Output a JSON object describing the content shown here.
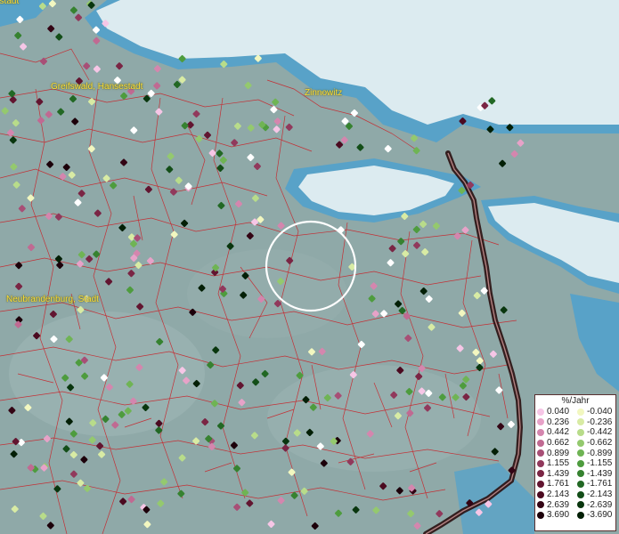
{
  "places": [
    {
      "id": "place-greifswald",
      "label": "Greifswald, Hansestadt"
    },
    {
      "id": "place-zinnowitz",
      "label": "Zinnowitz"
    },
    {
      "id": "place-neubrandenburg",
      "label": "Neubrandenburg, Stadt"
    },
    {
      "id": "place-top-left",
      "label": "estadt"
    }
  ],
  "legend": {
    "title": "%/Jahr",
    "positive": [
      {
        "label": "0.040",
        "color": "#f6c6e6"
      },
      {
        "label": "0.236",
        "color": "#e7a2c8"
      },
      {
        "label": "0.442",
        "color": "#d486ae"
      },
      {
        "label": "0.662",
        "color": "#c06a92"
      },
      {
        "label": "0.899",
        "color": "#a84f76"
      },
      {
        "label": "1.155",
        "color": "#91395c"
      },
      {
        "label": "1.439",
        "color": "#7a2544"
      },
      {
        "label": "1.761",
        "color": "#621530"
      },
      {
        "label": "2.143",
        "color": "#4b0a20"
      },
      {
        "label": "2.639",
        "color": "#330414"
      },
      {
        "label": "3.690",
        "color": "#1c000a"
      }
    ],
    "negative": [
      {
        "label": "-0.040",
        "color": "#f2f7c0"
      },
      {
        "label": "-0.236",
        "color": "#d8eba4"
      },
      {
        "label": "-0.442",
        "color": "#b8dc8a"
      },
      {
        "label": "-0.662",
        "color": "#94c96e"
      },
      {
        "label": "-0.899",
        "color": "#6fb454"
      },
      {
        "label": "-1.155",
        "color": "#4e9c3e"
      },
      {
        "label": "-1.439",
        "color": "#368230"
      },
      {
        "label": "-1.761",
        "color": "#226824"
      },
      {
        "label": "-2.143",
        "color": "#134e18"
      },
      {
        "label": "-2.639",
        "color": "#09360e"
      },
      {
        "label": "-3.690",
        "color": "#031f06"
      }
    ]
  },
  "colors": {
    "land": "#8fa9a8",
    "sea": "#dcebf0",
    "coast": "#58a2c8",
    "borders": "#c8242a",
    "selection_ring": "#ffffff"
  }
}
